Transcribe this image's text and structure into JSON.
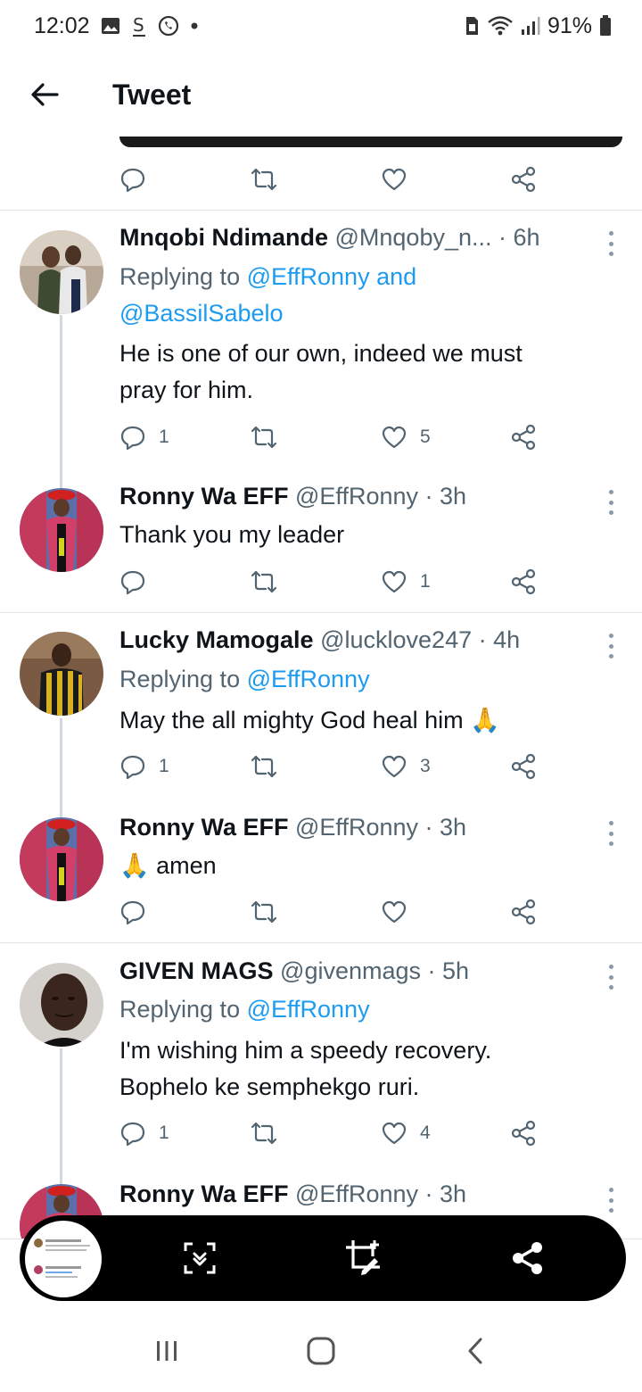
{
  "status_bar": {
    "time": "12:02",
    "battery": "91%",
    "left_icons": [
      "gallery-icon",
      "dollar-icon",
      "whatsapp-icon",
      "dot-icon"
    ],
    "right_icons": [
      "sim-icon",
      "wifi-icon",
      "signal-icon",
      "battery-icon"
    ]
  },
  "header": {
    "title": "Tweet"
  },
  "tweets": [
    {
      "name": "Mnqobi Ndimande",
      "handle": "@Mnqoby_n...",
      "time": "· 6h",
      "replying_prefix": "Replying to ",
      "replying_to": "@EffRonny and",
      "replying_to_2": "@BassilSabelo",
      "body_1": "He is one of our own, indeed we must",
      "body_2": "pray for him.",
      "replies": "1",
      "likes": "5"
    },
    {
      "name": "Ronny Wa EFF",
      "handle": "@EffRonny",
      "time": "· 3h",
      "body_1": "Thank you my leader",
      "likes": "1"
    },
    {
      "name": "Lucky Mamogale",
      "handle": "@lucklove247",
      "time": "· 4h",
      "replying_prefix": "Replying to ",
      "replying_to": "@EffRonny",
      "body_1": "May the all mighty God heal him 🙏",
      "replies": "1",
      "likes": "3"
    },
    {
      "name": "Ronny Wa EFF",
      "handle": "@EffRonny",
      "time": "· 3h",
      "body_1": "🙏 amen"
    },
    {
      "name": "GIVEN MAGS",
      "handle": "@givenmags",
      "time": "· 5h",
      "replying_prefix": "Replying to ",
      "replying_to": "@EffRonny",
      "body_1": "I'm wishing him a speedy recovery.",
      "body_2": "Bophelo ke semphekgo ruri.",
      "replies": "1",
      "likes": "4"
    },
    {
      "name": "Ronny Wa EFF",
      "handle": "@EffRonny",
      "time": "· 3h"
    }
  ],
  "toolbar": {
    "icons": [
      "scroll-capture-icon",
      "crop-edit-icon",
      "share-icon"
    ]
  },
  "nav": {
    "icons": [
      "recents-icon",
      "home-icon",
      "back-icon"
    ]
  },
  "colors": {
    "link": "#1d9bf0",
    "secondary_text": "#536471",
    "primary_text": "#0f1419"
  }
}
